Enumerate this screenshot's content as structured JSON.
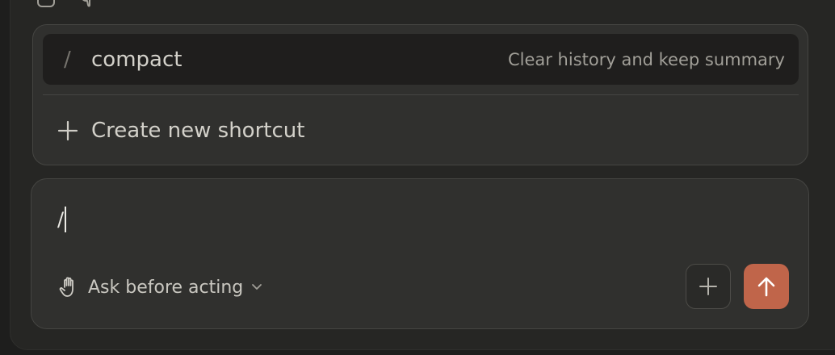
{
  "colors": {
    "accent": "#c0654a",
    "panel": "#30302e",
    "background": "#262624"
  },
  "top_icons": [
    "copy-icon",
    "thumbs-down-icon"
  ],
  "popup": {
    "command": {
      "prefix": "/",
      "name": "compact",
      "description": "Clear history and keep summary"
    },
    "create_label": "Create new shortcut",
    "create_icon": "plus-icon"
  },
  "composer": {
    "input_value": "/",
    "mode": {
      "label": "Ask before acting",
      "icon": "hand-icon",
      "dropdown_icon": "chevron-down-icon"
    },
    "add_icon": "plus-icon",
    "send_icon": "arrow-up-icon"
  }
}
